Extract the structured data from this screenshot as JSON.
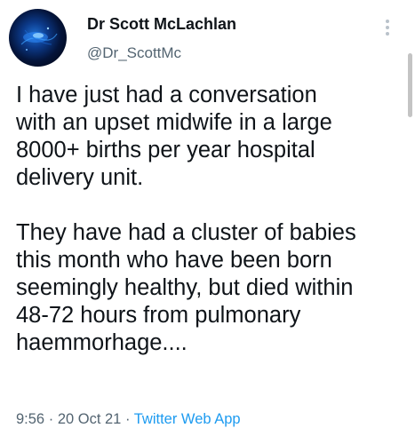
{
  "author": {
    "name": "Dr Scott McLachlan",
    "handle": "@Dr_ScottMc"
  },
  "tweet": {
    "lines": [
      "I have just had a conversation",
      "with an upset midwife in a large",
      "8000+ births per year hospital",
      "delivery unit.",
      "",
      "They have had a cluster of babies",
      "this month who have been born",
      "seemingly healthy, but died within",
      "48-72 hours from pulmonary",
      "haemmorhage...."
    ]
  },
  "meta": {
    "time": "9:56",
    "separator": "·",
    "date": "20 Oct 21",
    "source": "Twitter Web App"
  },
  "icons": {
    "more": "more-vertical-icon"
  },
  "colors": {
    "text": "#0f1419",
    "secondary": "#536471",
    "link": "#1d9bf0"
  }
}
